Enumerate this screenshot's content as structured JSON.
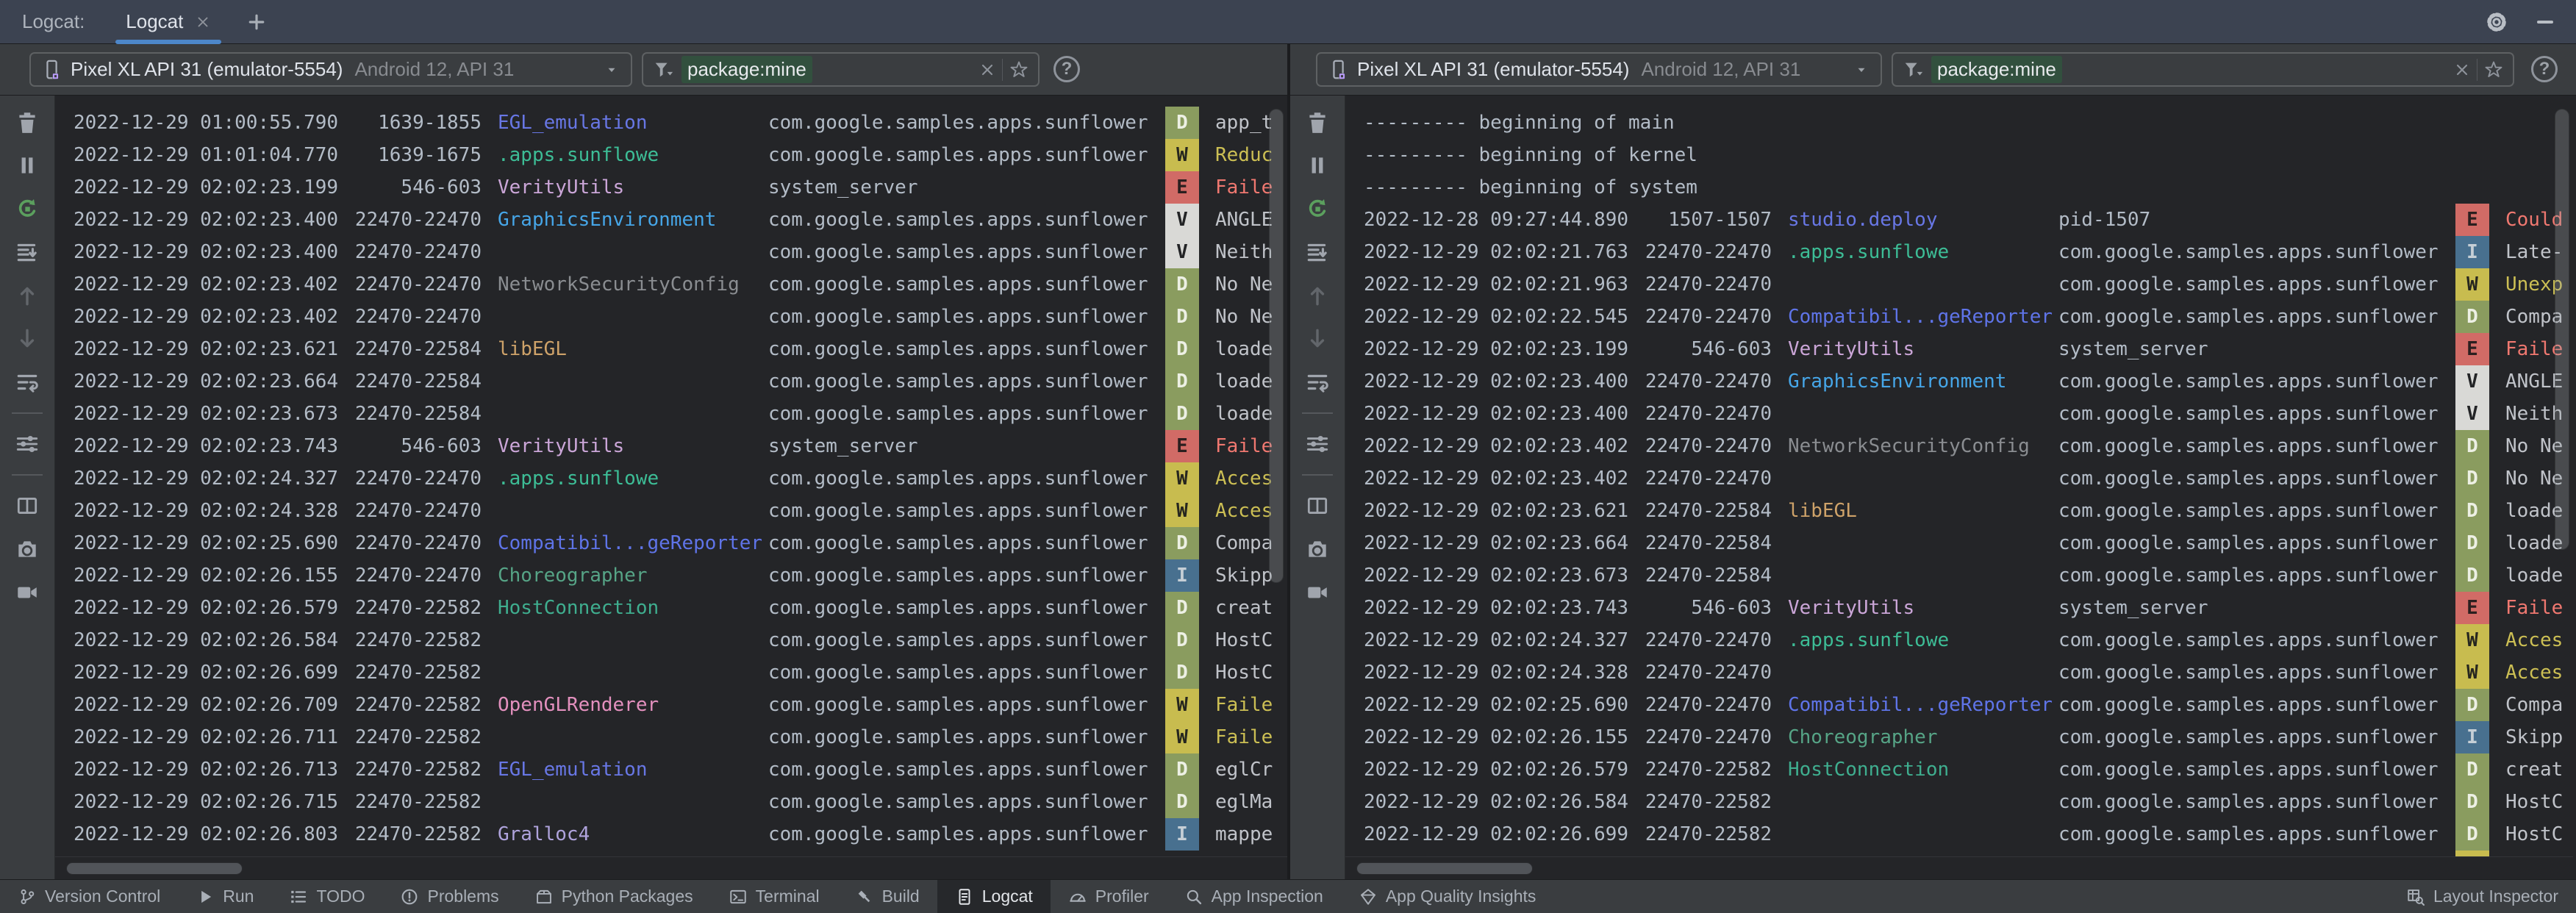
{
  "window": {
    "title_label": "Logcat:",
    "tab_label": "Logcat",
    "add_tab": "+",
    "help_label": "?"
  },
  "palette": {
    "css": {
      "bg-log": "#242528",
      "bg-strip": "#3A3D40",
      "bg-tabbar": "#3C4351",
      "border": "#1B1C1E",
      "combo-border": "#5E6163",
      "accent": "#4D87C9",
      "token-bg": "#32503E",
      "fg-log": "#B3BCC7",
      "fg-ui": "#A8AEB8",
      "lv-d-bg": "#8A9C5F",
      "lv-d-fg": "#EDF0E4",
      "lv-w-bg": "#C8BC4F",
      "lv-e-bg": "#D16B66",
      "lv-v-bg": "#D9D9D6",
      "lv-i-bg": "#48708F",
      "msg-w": "#CCBF54",
      "msg-e": "#F07870"
    },
    "tags": {
      "EGL_emulation": "#6877E5",
      "studio.deploy": "#6877E5",
      "Compatibil...geReporter": "#5F74E8",
      ".apps.sunflowe": "#3DBD96",
      "HostConnection": "#3FAE8F",
      "Choreographer": "#56A486",
      "VerityUtils": "#CBA6D8",
      "GraphicsEnvironment": "#46A6E8",
      "NetworkSecurityConfig": "#8A8D91",
      "libEGL": "#CEA269",
      "OpenGLRenderer": "#E390BE",
      "Gralloc4": "#AFA3DC"
    }
  },
  "side_toolbar": [
    {
      "icon": "trash",
      "name": "clear-logcat"
    },
    {
      "icon": "pause",
      "name": "pause-logcat"
    },
    {
      "icon": "restart",
      "name": "restart-logcat",
      "green": true
    },
    {
      "icon": "scrollend",
      "name": "scroll-to-end"
    },
    {
      "icon": "arrow-up",
      "name": "previous-occurrence",
      "dim": true
    },
    {
      "icon": "arrow-down",
      "name": "next-occurrence",
      "dim": true
    },
    {
      "icon": "softwrap",
      "name": "soft-wrap"
    },
    {
      "sep": true
    },
    {
      "icon": "sliders",
      "name": "logcat-formatting-options"
    },
    {
      "sep": true
    },
    {
      "icon": "split",
      "name": "split-panels"
    },
    {
      "icon": "camera",
      "name": "take-screenshot"
    },
    {
      "icon": "video",
      "name": "record-screen"
    }
  ],
  "panels": [
    {
      "device": {
        "name": "Pixel XL API 31 (emulator-5554)",
        "sub": "Android 12, API 31"
      },
      "filter": {
        "value": "package:mine"
      },
      "rows": [
        {
          "t": "2022-12-29 01:00:55.790",
          "p": "1639-1855",
          "tag": "EGL_emulation",
          "pkg": "com.google.samples.apps.sunflower",
          "lv": "D",
          "msg": "app_t"
        },
        {
          "t": "2022-12-29 01:01:04.770",
          "p": "1639-1675",
          "tag": ".apps.sunflowe",
          "pkg": "com.google.samples.apps.sunflower",
          "lv": "W",
          "msg": "Reduc"
        },
        {
          "t": "2022-12-29 02:02:23.199",
          "p": "546-603",
          "tag": "VerityUtils",
          "pkg": "system_server",
          "lv": "E",
          "msg": "Faile"
        },
        {
          "t": "2022-12-29 02:02:23.400",
          "p": "22470-22470",
          "tag": "GraphicsEnvironment",
          "pkg": "com.google.samples.apps.sunflower",
          "lv": "V",
          "msg": "ANGLE"
        },
        {
          "t": "2022-12-29 02:02:23.400",
          "p": "22470-22470",
          "tag": "",
          "pkg": "com.google.samples.apps.sunflower",
          "lv": "V",
          "msg": "Neith"
        },
        {
          "t": "2022-12-29 02:02:23.402",
          "p": "22470-22470",
          "tag": "NetworkSecurityConfig",
          "pkg": "com.google.samples.apps.sunflower",
          "lv": "D",
          "msg": "No Ne"
        },
        {
          "t": "2022-12-29 02:02:23.402",
          "p": "22470-22470",
          "tag": "",
          "pkg": "com.google.samples.apps.sunflower",
          "lv": "D",
          "msg": "No Ne"
        },
        {
          "t": "2022-12-29 02:02:23.621",
          "p": "22470-22584",
          "tag": "libEGL",
          "pkg": "com.google.samples.apps.sunflower",
          "lv": "D",
          "msg": "loade"
        },
        {
          "t": "2022-12-29 02:02:23.664",
          "p": "22470-22584",
          "tag": "",
          "pkg": "com.google.samples.apps.sunflower",
          "lv": "D",
          "msg": "loade"
        },
        {
          "t": "2022-12-29 02:02:23.673",
          "p": "22470-22584",
          "tag": "",
          "pkg": "com.google.samples.apps.sunflower",
          "lv": "D",
          "msg": "loade"
        },
        {
          "t": "2022-12-29 02:02:23.743",
          "p": "546-603",
          "tag": "VerityUtils",
          "pkg": "system_server",
          "lv": "E",
          "msg": "Faile"
        },
        {
          "t": "2022-12-29 02:02:24.327",
          "p": "22470-22470",
          "tag": ".apps.sunflowe",
          "pkg": "com.google.samples.apps.sunflower",
          "lv": "W",
          "msg": "Acces"
        },
        {
          "t": "2022-12-29 02:02:24.328",
          "p": "22470-22470",
          "tag": "",
          "pkg": "com.google.samples.apps.sunflower",
          "lv": "W",
          "msg": "Acces"
        },
        {
          "t": "2022-12-29 02:02:25.690",
          "p": "22470-22470",
          "tag": "Compatibil...geReporter",
          "pkg": "com.google.samples.apps.sunflower",
          "lv": "D",
          "msg": "Compa"
        },
        {
          "t": "2022-12-29 02:02:26.155",
          "p": "22470-22470",
          "tag": "Choreographer",
          "pkg": "com.google.samples.apps.sunflower",
          "lv": "I",
          "msg": "Skipp"
        },
        {
          "t": "2022-12-29 02:02:26.579",
          "p": "22470-22582",
          "tag": "HostConnection",
          "pkg": "com.google.samples.apps.sunflower",
          "lv": "D",
          "msg": "creat"
        },
        {
          "t": "2022-12-29 02:02:26.584",
          "p": "22470-22582",
          "tag": "",
          "pkg": "com.google.samples.apps.sunflower",
          "lv": "D",
          "msg": "HostC"
        },
        {
          "t": "2022-12-29 02:02:26.699",
          "p": "22470-22582",
          "tag": "",
          "pkg": "com.google.samples.apps.sunflower",
          "lv": "D",
          "msg": "HostC"
        },
        {
          "t": "2022-12-29 02:02:26.709",
          "p": "22470-22582",
          "tag": "OpenGLRenderer",
          "pkg": "com.google.samples.apps.sunflower",
          "lv": "W",
          "msg": "Faile"
        },
        {
          "t": "2022-12-29 02:02:26.711",
          "p": "22470-22582",
          "tag": "",
          "pkg": "com.google.samples.apps.sunflower",
          "lv": "W",
          "msg": "Faile"
        },
        {
          "t": "2022-12-29 02:02:26.713",
          "p": "22470-22582",
          "tag": "EGL_emulation",
          "pkg": "com.google.samples.apps.sunflower",
          "lv": "D",
          "msg": "eglCr"
        },
        {
          "t": "2022-12-29 02:02:26.715",
          "p": "22470-22582",
          "tag": "",
          "pkg": "com.google.samples.apps.sunflower",
          "lv": "D",
          "msg": "eglMa"
        },
        {
          "t": "2022-12-29 02:02:26.803",
          "p": "22470-22582",
          "tag": "Gralloc4",
          "pkg": "com.google.samples.apps.sunflower",
          "lv": "I",
          "msg": "mappe"
        }
      ]
    },
    {
      "device": {
        "name": "Pixel XL API 31 (emulator-5554)",
        "sub": "Android 12, API 31"
      },
      "filter": {
        "value": "package:mine"
      },
      "rows": [
        {
          "marker": "--------- beginning of main"
        },
        {
          "marker": "--------- beginning of kernel"
        },
        {
          "marker": "--------- beginning of system"
        },
        {
          "t": "2022-12-28 09:27:44.890",
          "p": "1507-1507",
          "tag": "studio.deploy",
          "pkg": "pid-1507",
          "lv": "E",
          "msg": "Could"
        },
        {
          "t": "2022-12-29 02:02:21.763",
          "p": "22470-22470",
          "tag": ".apps.sunflowe",
          "pkg": "com.google.samples.apps.sunflower",
          "lv": "I",
          "msg": "Late-"
        },
        {
          "t": "2022-12-29 02:02:21.963",
          "p": "22470-22470",
          "tag": "",
          "pkg": "com.google.samples.apps.sunflower",
          "lv": "W",
          "msg": "Unexp"
        },
        {
          "t": "2022-12-29 02:02:22.545",
          "p": "22470-22470",
          "tag": "Compatibil...geReporter",
          "pkg": "com.google.samples.apps.sunflower",
          "lv": "D",
          "msg": "Compa"
        },
        {
          "t": "2022-12-29 02:02:23.199",
          "p": "546-603",
          "tag": "VerityUtils",
          "pkg": "system_server",
          "lv": "E",
          "msg": "Faile"
        },
        {
          "t": "2022-12-29 02:02:23.400",
          "p": "22470-22470",
          "tag": "GraphicsEnvironment",
          "pkg": "com.google.samples.apps.sunflower",
          "lv": "V",
          "msg": "ANGLE"
        },
        {
          "t": "2022-12-29 02:02:23.400",
          "p": "22470-22470",
          "tag": "",
          "pkg": "com.google.samples.apps.sunflower",
          "lv": "V",
          "msg": "Neith"
        },
        {
          "t": "2022-12-29 02:02:23.402",
          "p": "22470-22470",
          "tag": "NetworkSecurityConfig",
          "pkg": "com.google.samples.apps.sunflower",
          "lv": "D",
          "msg": "No Ne"
        },
        {
          "t": "2022-12-29 02:02:23.402",
          "p": "22470-22470",
          "tag": "",
          "pkg": "com.google.samples.apps.sunflower",
          "lv": "D",
          "msg": "No Ne"
        },
        {
          "t": "2022-12-29 02:02:23.621",
          "p": "22470-22584",
          "tag": "libEGL",
          "pkg": "com.google.samples.apps.sunflower",
          "lv": "D",
          "msg": "loade"
        },
        {
          "t": "2022-12-29 02:02:23.664",
          "p": "22470-22584",
          "tag": "",
          "pkg": "com.google.samples.apps.sunflower",
          "lv": "D",
          "msg": "loade"
        },
        {
          "t": "2022-12-29 02:02:23.673",
          "p": "22470-22584",
          "tag": "",
          "pkg": "com.google.samples.apps.sunflower",
          "lv": "D",
          "msg": "loade"
        },
        {
          "t": "2022-12-29 02:02:23.743",
          "p": "546-603",
          "tag": "VerityUtils",
          "pkg": "system_server",
          "lv": "E",
          "msg": "Faile"
        },
        {
          "t": "2022-12-29 02:02:24.327",
          "p": "22470-22470",
          "tag": ".apps.sunflowe",
          "pkg": "com.google.samples.apps.sunflower",
          "lv": "W",
          "msg": "Acces"
        },
        {
          "t": "2022-12-29 02:02:24.328",
          "p": "22470-22470",
          "tag": "",
          "pkg": "com.google.samples.apps.sunflower",
          "lv": "W",
          "msg": "Acces"
        },
        {
          "t": "2022-12-29 02:02:25.690",
          "p": "22470-22470",
          "tag": "Compatibil...geReporter",
          "pkg": "com.google.samples.apps.sunflower",
          "lv": "D",
          "msg": "Compa"
        },
        {
          "t": "2022-12-29 02:02:26.155",
          "p": "22470-22470",
          "tag": "Choreographer",
          "pkg": "com.google.samples.apps.sunflower",
          "lv": "I",
          "msg": "Skipp"
        },
        {
          "t": "2022-12-29 02:02:26.579",
          "p": "22470-22582",
          "tag": "HostConnection",
          "pkg": "com.google.samples.apps.sunflower",
          "lv": "D",
          "msg": "creat"
        },
        {
          "t": "2022-12-29 02:02:26.584",
          "p": "22470-22582",
          "tag": "",
          "pkg": "com.google.samples.apps.sunflower",
          "lv": "D",
          "msg": "HostC"
        },
        {
          "t": "2022-12-29 02:02:26.699",
          "p": "22470-22582",
          "tag": "",
          "pkg": "com.google.samples.apps.sunflower",
          "lv": "D",
          "msg": "HostC"
        },
        {
          "t": "",
          "p": "",
          "tag": "",
          "pkg": "",
          "lv": "W",
          "msg": ""
        }
      ]
    }
  ],
  "statusbar": {
    "left": [
      {
        "icon": "branch",
        "label": "Version Control"
      },
      {
        "icon": "play",
        "label": "Run"
      },
      {
        "icon": "todo",
        "label": "TODO"
      },
      {
        "icon": "problem",
        "label": "Problems"
      },
      {
        "icon": "package",
        "label": "Python Packages"
      },
      {
        "icon": "terminal",
        "label": "Terminal"
      },
      {
        "icon": "build",
        "label": "Build"
      },
      {
        "icon": "logcat",
        "label": "Logcat",
        "active": true
      },
      {
        "icon": "profiler",
        "label": "Profiler"
      },
      {
        "icon": "inspection",
        "label": "App Inspection"
      },
      {
        "icon": "aqi",
        "label": "App Quality Insights"
      }
    ],
    "right": [
      {
        "icon": "layoutinspector",
        "label": "Layout Inspector"
      }
    ]
  }
}
